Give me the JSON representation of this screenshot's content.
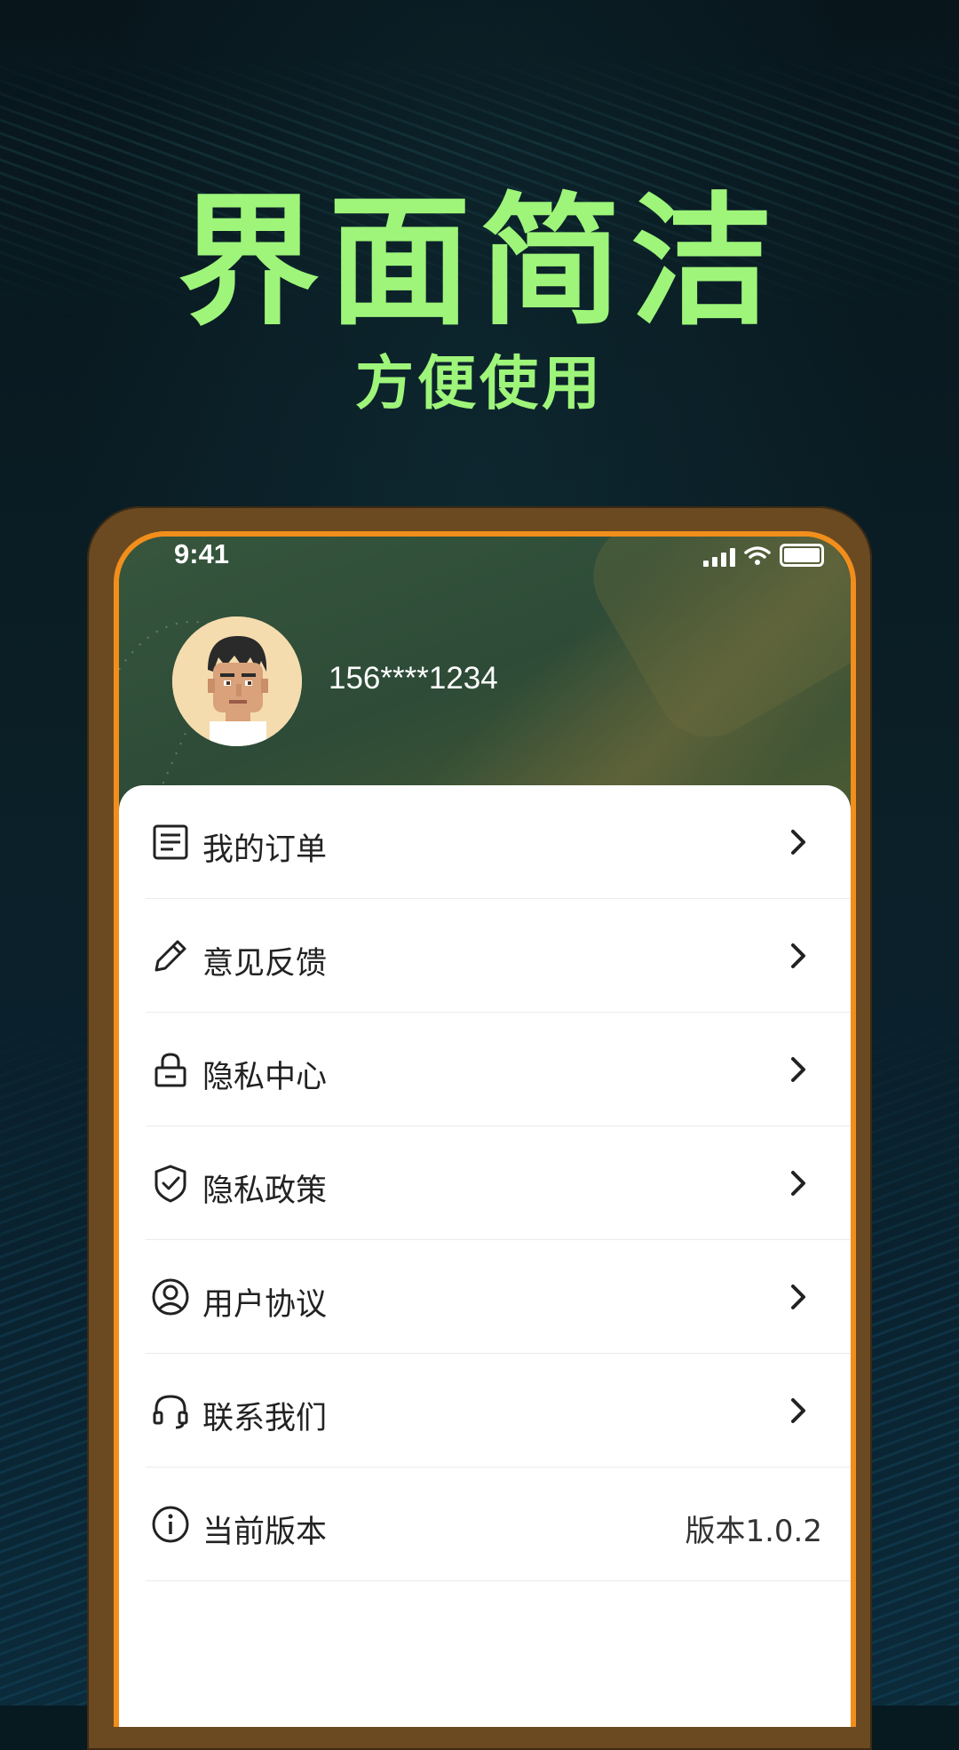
{
  "promo": {
    "headline": "界面简洁",
    "subheadline": "方便使用"
  },
  "status_bar": {
    "time": "9:41"
  },
  "profile": {
    "phone": "156****1234"
  },
  "menu": [
    {
      "label": "我的订单",
      "icon": "order-list-icon"
    },
    {
      "label": "意见反馈",
      "icon": "pencil-icon"
    },
    {
      "label": "隐私中心",
      "icon": "lock-icon"
    },
    {
      "label": "隐私政策",
      "icon": "shield-check-icon"
    },
    {
      "label": "用户协议",
      "icon": "user-circle-icon"
    },
    {
      "label": "联系我们",
      "icon": "headset-icon"
    },
    {
      "label": "当前版本",
      "icon": "info-icon",
      "value": "版本1.0.2"
    }
  ],
  "colors": {
    "accent_green": "#9ef57a",
    "phone_frame": "#f18e1c",
    "header_green": "#2c4a38"
  }
}
